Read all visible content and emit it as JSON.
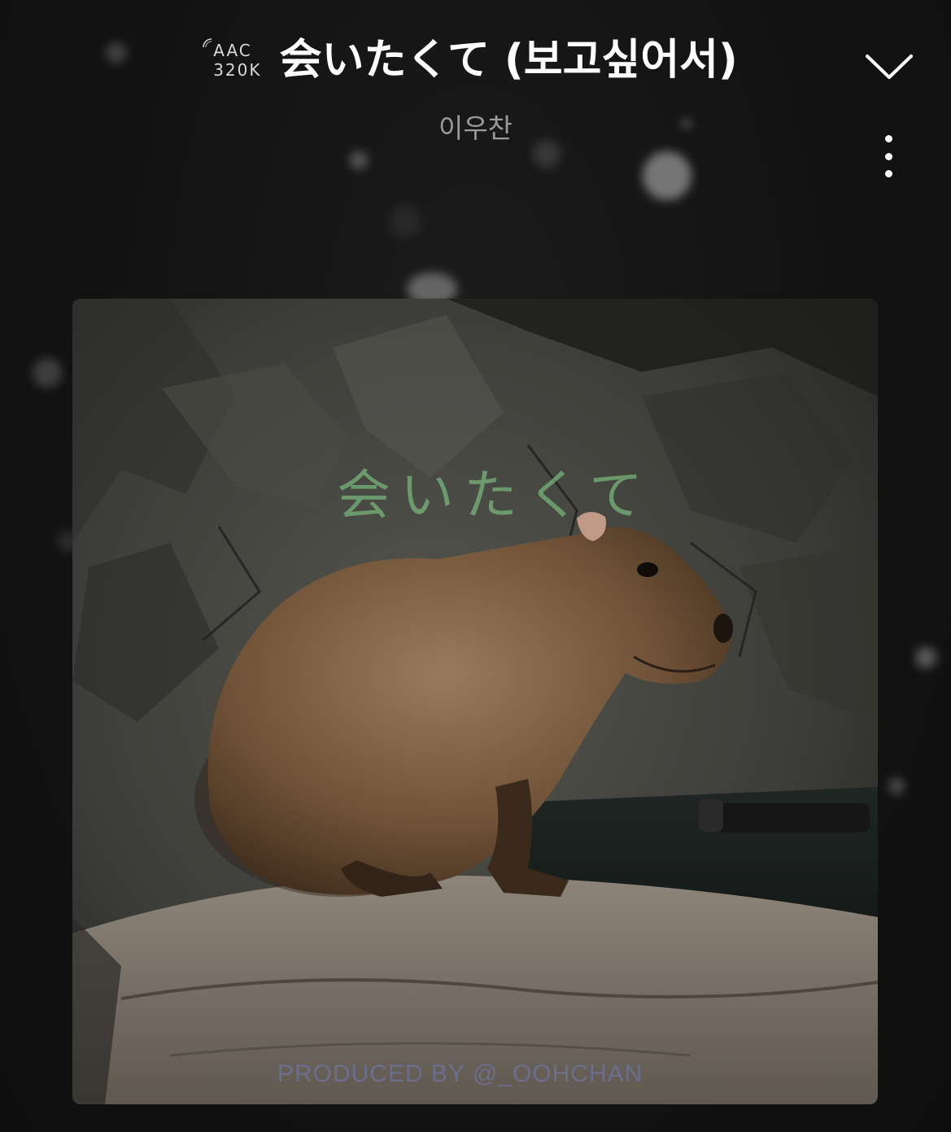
{
  "player": {
    "quality": {
      "codec": "AAC",
      "bitrate": "320K",
      "icon": "signal-wave-icon"
    },
    "song_title": "会いたくて (보고싶어서)",
    "artist": "이우찬",
    "collapse_icon": "chevron-down-icon",
    "more_icon": "more-vertical-icon",
    "album_art": {
      "title_text": "会いたくて",
      "credit_text": "PRODUCED BY @_OOHCHAN",
      "subject": "capybara-photo"
    }
  },
  "colors": {
    "background": "#121212",
    "title": "#ffffff",
    "artist": "#9a9a9a",
    "art_title": "#78b97d"
  }
}
